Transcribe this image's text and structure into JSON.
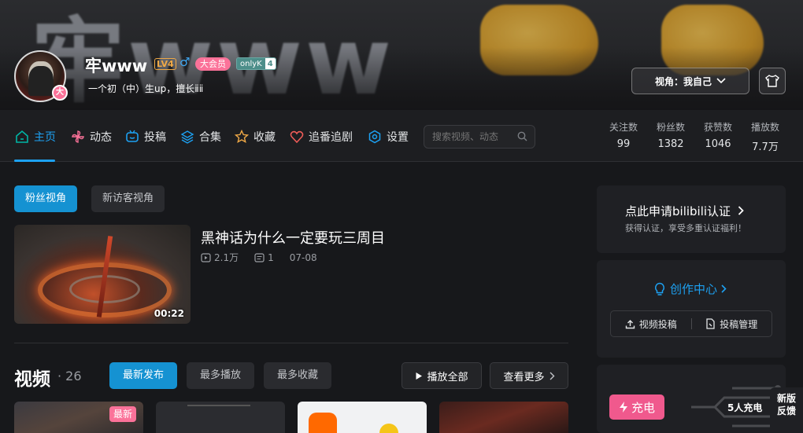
{
  "banner": {
    "art_text": "牢www"
  },
  "user": {
    "name": "牢www",
    "level": "LV4",
    "sex_icon": "male-icon",
    "vip_label": "大会员",
    "avatar_badge": "大",
    "medal": {
      "name": "onlyK",
      "level": "4"
    },
    "sign": "一个初（中）生up，擅长ⅱⅱ"
  },
  "header": {
    "view_label": "视角：我自己"
  },
  "nav": {
    "items": [
      {
        "label": "主页",
        "icon": "home-icon",
        "color": "#00b5a5"
      },
      {
        "label": "动态",
        "icon": "pinwheel-icon",
        "color": "#fb7299"
      },
      {
        "label": "投稿",
        "icon": "tv-icon",
        "color": "#1da1f2"
      },
      {
        "label": "合集",
        "icon": "layers-icon",
        "color": "#1da1f2"
      },
      {
        "label": "收藏",
        "icon": "star-icon",
        "color": "#f0a946"
      },
      {
        "label": "追番追剧",
        "icon": "heart-icon",
        "color": "#f25d59"
      },
      {
        "label": "设置",
        "icon": "settings-icon",
        "color": "#1da1f2"
      }
    ],
    "search_placeholder": "搜索视频、动态"
  },
  "stats": [
    {
      "label": "关注数",
      "value": "99"
    },
    {
      "label": "粉丝数",
      "value": "1382"
    },
    {
      "label": "获赞数",
      "value": "1046"
    },
    {
      "label": "播放数",
      "value": "7.7万"
    }
  ],
  "perspective": {
    "active": "粉丝视角",
    "inactive": "新访客视角"
  },
  "featured": {
    "title": "黑神话为什么一定要玩三周目",
    "plays": "2.1万",
    "comments": "1",
    "date": "07-08",
    "duration": "00:22"
  },
  "videos": {
    "title": "视频",
    "count": "26",
    "tabs": [
      "最新发布",
      "最多播放",
      "最多收藏"
    ],
    "play_all": "播放全部",
    "see_more": "查看更多",
    "new_tag": "最新"
  },
  "sidebar": {
    "verify_title": "点此申请bilibili认证",
    "verify_sub": "获得认证，享受多重认证福利！",
    "creator_title": "创作中心",
    "creator_buttons": [
      "视频投稿",
      "投稿管理"
    ],
    "charge_label": "充电",
    "charge_count": "5人充电"
  },
  "float": {
    "line1": "新版",
    "line2": "反馈"
  },
  "colors": {
    "accent": "#1592d2",
    "pink": "#fb7299",
    "bg": "#17181b"
  }
}
